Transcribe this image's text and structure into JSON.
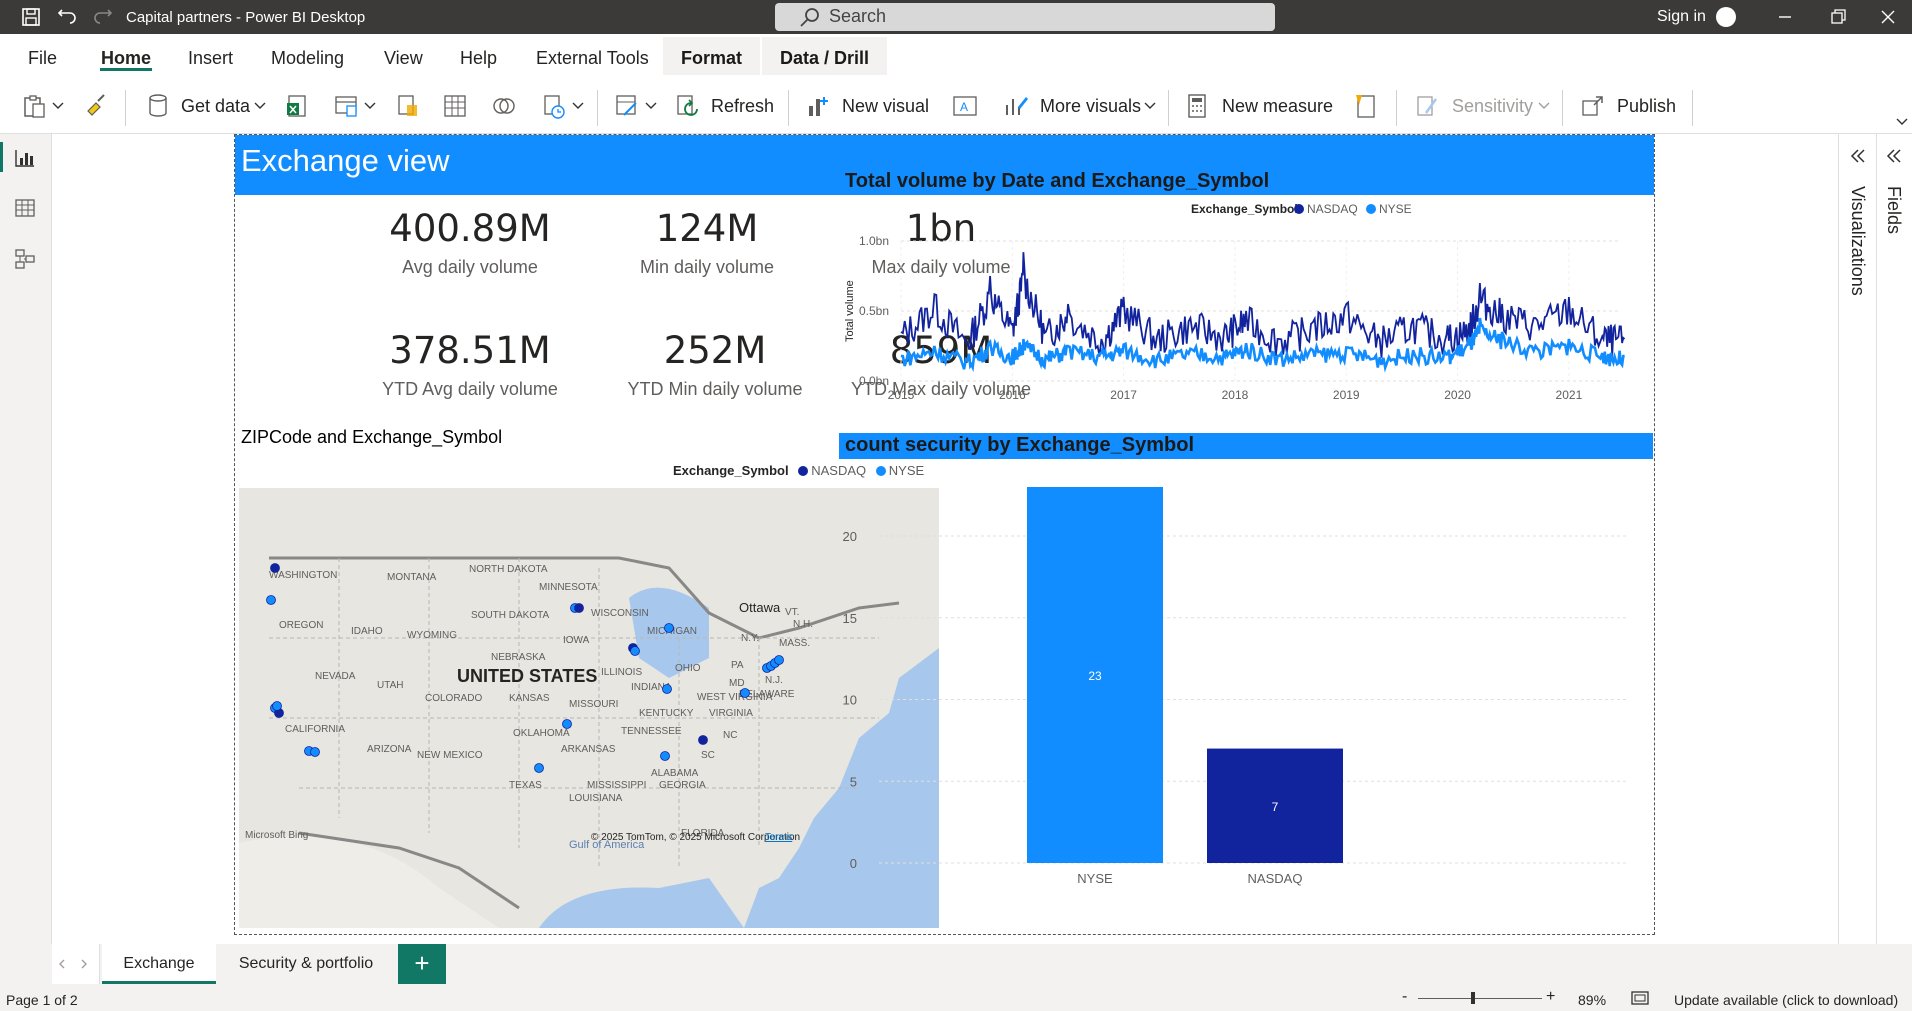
{
  "window": {
    "title": "Capital partners - Power BI Desktop",
    "search_placeholder": "Search",
    "sign_in": "Sign in"
  },
  "menu": {
    "tabs": [
      "File",
      "Home",
      "Insert",
      "Modeling",
      "View",
      "Help",
      "External Tools",
      "Format",
      "Data / Drill"
    ],
    "active": "Home"
  },
  "ribbon": {
    "get_data": "Get data",
    "refresh": "Refresh",
    "new_visual": "New visual",
    "more_visuals": "More visuals",
    "new_measure": "New measure",
    "sensitivity": "Sensitivity",
    "publish": "Publish"
  },
  "report": {
    "header_title": "Exchange view",
    "kpis": [
      {
        "value": "400.89M",
        "label": "Avg daily volume"
      },
      {
        "value": "124M",
        "label": "Min daily volume"
      },
      {
        "value": "1bn",
        "label": "Max daily volume"
      },
      {
        "value": "378.51M",
        "label": "YTD Avg daily volume"
      },
      {
        "value": "252M",
        "label": "YTD Min daily volume"
      },
      {
        "value": "859M",
        "label": "YTD Max daily volume"
      }
    ],
    "map": {
      "title": "ZIPCode and Exchange_Symbol",
      "legend_title": "Exchange_Symbol",
      "legend_items": [
        "NASDAQ",
        "NYSE"
      ],
      "country_label": "UNITED STATES",
      "state_labels": [
        "WASHINGTON",
        "MONTANA",
        "NORTH DAKOTA",
        "MINNESOTA",
        "OREGON",
        "IDAHO",
        "SOUTH DAKOTA",
        "WISCONSIN",
        "WYOMING",
        "MICHIGAN",
        "IOWA",
        "NEBRASKA",
        "NEVADA",
        "UTAH",
        "COLORADO",
        "ILLINOIS",
        "INDIANA",
        "OHIO",
        "PA",
        "KANSAS",
        "MISSOURI",
        "WEST VIRGINIA",
        "VIRGINIA",
        "KENTUCKY",
        "CALIFORNIA",
        "TENNESSEE",
        "NC",
        "OKLAHOMA",
        "ARIZONA",
        "NEW MEXICO",
        "ARKANSAS",
        "SC",
        "ALABAMA",
        "GEORGIA",
        "MISSISSIPPI",
        "TEXAS",
        "LOUISIANA",
        "FLORIDA",
        "N.Y.",
        "MASS.",
        "VT.",
        "N.H.",
        "MD",
        "DELAWARE",
        "N.J.",
        "Ottawa"
      ],
      "attribution": "© 2025 TomTom, © 2025 Microsoft Corporation",
      "terms": "Terms",
      "bing": "Microsoft Bing",
      "gulf": "Gulf of America"
    },
    "line_chart_title": "Total volume by Date and Exchange_Symbol",
    "bar_chart_title": "count security by Exchange_Symbol"
  },
  "colors": {
    "nasdaq": "#12239e",
    "nyse": "#118dff",
    "accent": "#118dff"
  },
  "chart_data": [
    {
      "type": "line",
      "title": "Total volume by Date and Exchange_Symbol",
      "xlabel": "",
      "ylabel": "Total volume",
      "x_ticks": [
        "2015",
        "2016",
        "2017",
        "2018",
        "2019",
        "2020",
        "2021"
      ],
      "y_ticks": [
        "0.0bn",
        "0.5bn",
        "1.0bn"
      ],
      "ylim": [
        0,
        1.0
      ],
      "legend_title": "Exchange_Symbol",
      "legend_position": "top-right",
      "series": [
        {
          "name": "NASDAQ",
          "x": [
            2015.0,
            2015.3,
            2015.6,
            2015.8,
            2016.0,
            2016.1,
            2016.3,
            2016.5,
            2016.8,
            2017.0,
            2017.3,
            2017.6,
            2017.9,
            2018.1,
            2018.4,
            2018.7,
            2019.0,
            2019.3,
            2019.6,
            2019.9,
            2020.1,
            2020.2,
            2020.4,
            2020.7,
            2021.0,
            2021.3,
            2021.5
          ],
          "values": [
            0.35,
            0.62,
            0.28,
            0.75,
            0.4,
            0.92,
            0.35,
            0.55,
            0.3,
            0.6,
            0.32,
            0.45,
            0.35,
            0.5,
            0.3,
            0.42,
            0.55,
            0.3,
            0.45,
            0.33,
            0.4,
            0.7,
            0.55,
            0.45,
            0.6,
            0.32,
            0.3
          ]
        },
        {
          "name": "NYSE",
          "x": [
            2015.0,
            2015.3,
            2015.6,
            2015.8,
            2016.0,
            2016.1,
            2016.3,
            2016.5,
            2016.8,
            2017.0,
            2017.3,
            2017.6,
            2017.9,
            2018.1,
            2018.4,
            2018.7,
            2019.0,
            2019.3,
            2019.6,
            2019.9,
            2020.1,
            2020.2,
            2020.4,
            2020.7,
            2021.0,
            2021.3,
            2021.5
          ],
          "values": [
            0.18,
            0.25,
            0.15,
            0.28,
            0.2,
            0.3,
            0.18,
            0.25,
            0.2,
            0.26,
            0.17,
            0.23,
            0.2,
            0.27,
            0.18,
            0.22,
            0.24,
            0.17,
            0.22,
            0.19,
            0.3,
            0.45,
            0.35,
            0.25,
            0.3,
            0.2,
            0.18
          ]
        }
      ]
    },
    {
      "type": "bar",
      "title": "count security by Exchange_Symbol",
      "categories": [
        "NYSE",
        "NASDAQ"
      ],
      "values": [
        23,
        7
      ],
      "data_labels": [
        "23",
        "7"
      ],
      "y_ticks": [
        0,
        5,
        10,
        15,
        20
      ],
      "ylim": [
        0,
        23
      ]
    }
  ],
  "page_tabs": [
    "Exchange",
    "Security & portfolio"
  ],
  "status": {
    "page": "Page 1 of 2",
    "zoom": "89%",
    "update": "Update available (click to download)"
  },
  "panes": {
    "visualizations": "Visualizations",
    "fields": "Fields"
  }
}
